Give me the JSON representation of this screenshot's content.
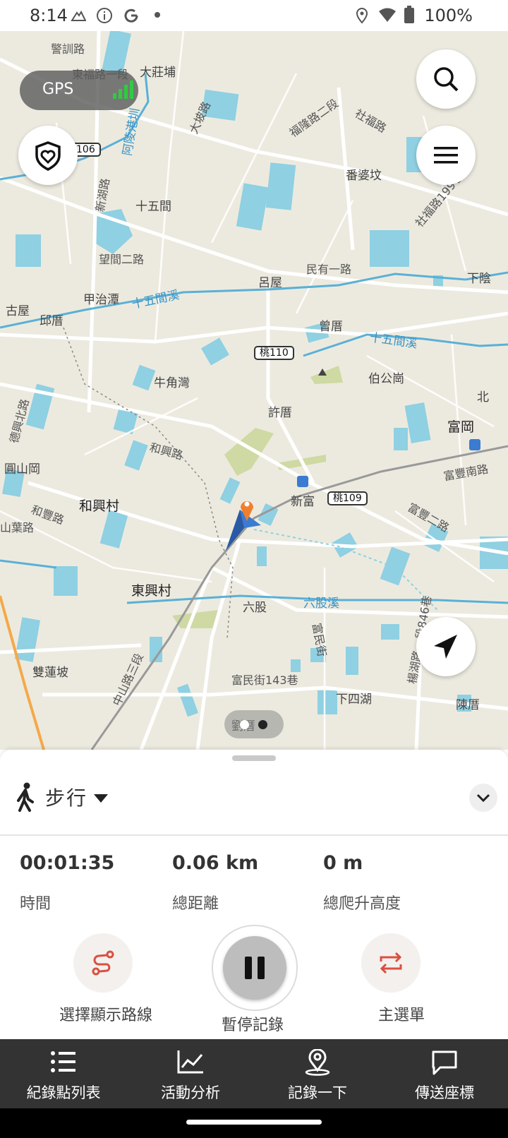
{
  "status_bar": {
    "time": "8:14",
    "battery": "100%",
    "left_icons": [
      "mountain-icon",
      "info-icon",
      "google-icon",
      "dot-icon"
    ],
    "right_icons": [
      "location-icon",
      "wifi-icon",
      "battery-icon"
    ]
  },
  "map": {
    "gps_label": "GPS",
    "labels": [
      {
        "text": "警訓路",
        "cls": "road"
      },
      {
        "text": "東福路一段",
        "cls": "road"
      },
      {
        "text": "大莊埔",
        "cls": ""
      },
      {
        "text": "大坡路",
        "cls": "road"
      },
      {
        "text": "福隆路二段",
        "cls": "road"
      },
      {
        "text": "社福路",
        "cls": "road"
      },
      {
        "text": "阿陵港圳",
        "cls": "water"
      },
      {
        "text": "番婆坟",
        "cls": ""
      },
      {
        "text": "新湖路",
        "cls": "road"
      },
      {
        "text": "十五間",
        "cls": ""
      },
      {
        "text": "社福路199巷",
        "cls": "road"
      },
      {
        "text": "望間二路",
        "cls": "road"
      },
      {
        "text": "呂屋",
        "cls": ""
      },
      {
        "text": "民有一路",
        "cls": "road"
      },
      {
        "text": "下陰",
        "cls": ""
      },
      {
        "text": "甲治潭",
        "cls": ""
      },
      {
        "text": "十五間溪",
        "cls": "water"
      },
      {
        "text": "古屋",
        "cls": ""
      },
      {
        "text": "邱厝",
        "cls": ""
      },
      {
        "text": "曾厝",
        "cls": ""
      },
      {
        "text": "十五間溪",
        "cls": "water"
      },
      {
        "text": "牛角灣",
        "cls": ""
      },
      {
        "text": "伯公崗",
        "cls": ""
      },
      {
        "text": "北",
        "cls": ""
      },
      {
        "text": "許厝",
        "cls": ""
      },
      {
        "text": "德興北路",
        "cls": "road"
      },
      {
        "text": "富岡",
        "cls": "big"
      },
      {
        "text": "和興路",
        "cls": "road"
      },
      {
        "text": "富豐南路",
        "cls": "road"
      },
      {
        "text": "圓山岡",
        "cls": ""
      },
      {
        "text": "新富",
        "cls": ""
      },
      {
        "text": "和豐路",
        "cls": "road"
      },
      {
        "text": "和興村",
        "cls": "big"
      },
      {
        "text": "富豐二路",
        "cls": "road"
      },
      {
        "text": "山葉路",
        "cls": "road"
      },
      {
        "text": "東興村",
        "cls": "big"
      },
      {
        "text": "六股",
        "cls": ""
      },
      {
        "text": "六股溪",
        "cls": "water"
      },
      {
        "text": "富民街",
        "cls": "road"
      },
      {
        "text": "楊湖路一段846巷",
        "cls": "road"
      },
      {
        "text": "雙蓮坡",
        "cls": ""
      },
      {
        "text": "中山路三段",
        "cls": "road"
      },
      {
        "text": "富民街143巷",
        "cls": "road"
      },
      {
        "text": "下四湖",
        "cls": ""
      },
      {
        "text": "陳厝",
        "cls": ""
      },
      {
        "text": "劉厝",
        "cls": ""
      }
    ],
    "shields": [
      "106",
      "桃110",
      "桃109"
    ]
  },
  "panel": {
    "activity_mode": "步行",
    "stats": [
      {
        "value": "00:01:35",
        "label": "時間"
      },
      {
        "value": "0.06 km",
        "label": "總距離"
      },
      {
        "value": "0 m",
        "label": "總爬升高度"
      }
    ],
    "actions": {
      "route_label": "選擇顯示路線",
      "pause_label": "暫停記錄",
      "menu_label": "主選單"
    }
  },
  "bottom_nav": [
    {
      "label": "紀錄點列表",
      "icon": "list-icon"
    },
    {
      "label": "活動分析",
      "icon": "chart-icon"
    },
    {
      "label": "記錄一下",
      "icon": "pin-icon"
    },
    {
      "label": "傳送座標",
      "icon": "message-icon"
    }
  ],
  "colors": {
    "map_land": "#eceadf",
    "water": "#8fd0e2",
    "accent_red": "#d9503f",
    "nav_bg": "#333333"
  }
}
